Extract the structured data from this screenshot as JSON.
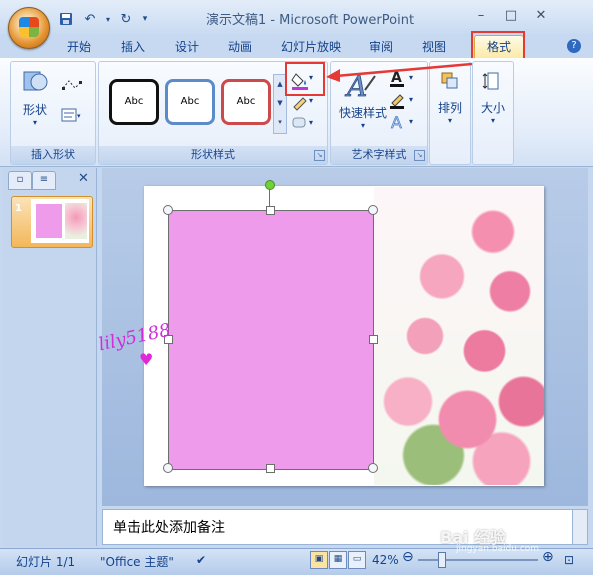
{
  "window": {
    "title": "演示文稿1 - Microsoft PowerPoint",
    "qat": {
      "save_icon": "save-icon",
      "undo_icon": "undo-icon",
      "redo_icon": "redo-icon"
    }
  },
  "tabs": [
    "开始",
    "插入",
    "设计",
    "动画",
    "幻灯片放映",
    "审阅",
    "视图",
    "格式"
  ],
  "ribbon": {
    "insert_shapes": {
      "shapes_label": "形状",
      "group_label": "插入形状"
    },
    "shape_styles": {
      "swatches": [
        "Abc",
        "Abc",
        "Abc"
      ],
      "group_label": "形状样式"
    },
    "wordart": {
      "quick_styles_label": "快速样式",
      "group_label": "艺术字样式"
    },
    "arrange_label": "排列",
    "size_label": "大小"
  },
  "slides_pane": {
    "slide_number": "1"
  },
  "notes": {
    "placeholder": "单击此处添加备注"
  },
  "watermark": "lily5188",
  "status": {
    "slide_info": "幻灯片 1/1",
    "theme": "\"Office 主题\"",
    "zoom": "42%"
  },
  "baidu_watermark": {
    "brand": "Bai 经验",
    "domain": "jingyan.baidu.com"
  },
  "colors": {
    "shape_fill": "#ef9bec",
    "highlight": "#e53935",
    "accent": "#15428b"
  }
}
